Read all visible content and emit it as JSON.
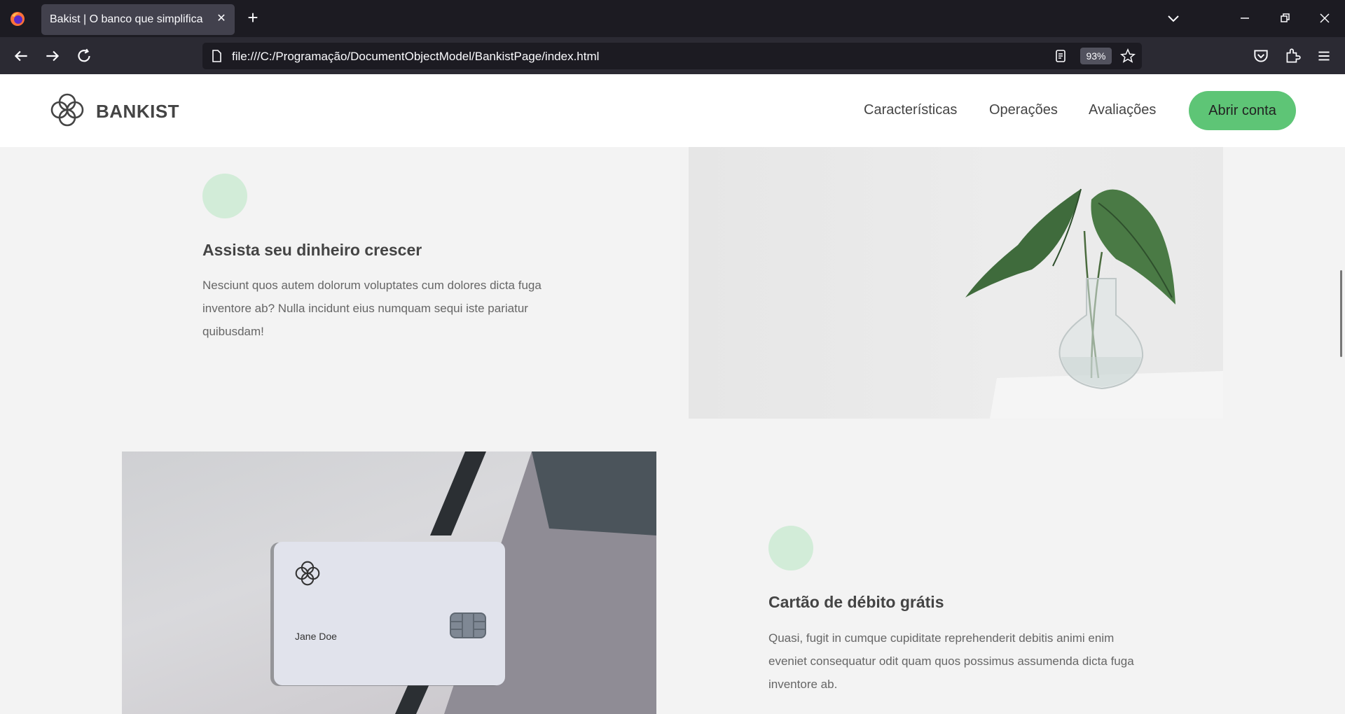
{
  "browser": {
    "tab_title": "Bakist | O banco que simplifica",
    "url": "file:///C:/Programação/DocumentObjectModel/BankistPage/index.html",
    "zoom": "93%"
  },
  "header": {
    "brand": "BANKIST",
    "nav": [
      "Características",
      "Operações",
      "Avaliações"
    ],
    "cta": "Abrir conta",
    "accent_color": "#5ec576"
  },
  "features": [
    {
      "title": "Assista seu dinheiro crescer",
      "text": "Nesciunt quos autem dolorum voluptates cum dolores dicta fuga inventore ab? Nulla incidunt eius numquam sequi iste pariatur quibusdam!"
    },
    {
      "title": "Cartão de débito grátis",
      "text": "Quasi, fugit in cumque cupiditate reprehenderit debitis animi enim eveniet consequatur odit quam quos possimus assumenda dicta fuga inventore ab."
    }
  ],
  "card": {
    "holder": "Jane Doe"
  }
}
